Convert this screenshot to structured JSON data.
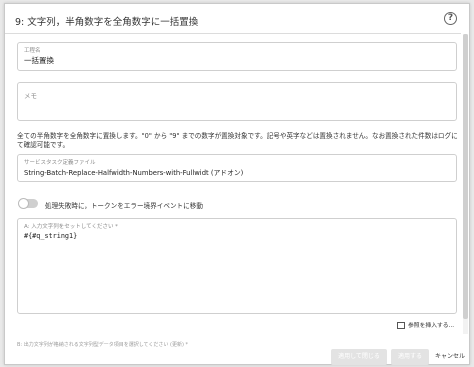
{
  "dialog": {
    "title": "9: 文字列，半角数字を全角数字に一括置換",
    "help_icon": "?"
  },
  "step_name": {
    "label": "工程名",
    "value": "一括置換"
  },
  "memo": {
    "label": "メモ",
    "value": ""
  },
  "description": "全ての半角数字を全角数字に置換します。\"0\" から \"9\" までの数字が置換対象です。記号や英字などは置換されません。なお置換された件数はログにて確認可能です。",
  "service_task": {
    "label": "サービスタスク定義ファイル",
    "value": "String-Batch-Replace-Halfwidth-Numbers-with-Fullwidt (アドオン)"
  },
  "error_toggle": {
    "label": "処理失敗時に，トークンをエラー境界イベントに移動",
    "enabled": false
  },
  "input_string": {
    "label": "A: 入力文字列をセットしてください *",
    "value": "#{#q_string1}"
  },
  "insert_reference": "参照を挿入する...",
  "output_hint": "B: 出力文字列が格納される文字列型データ項目を選択してください (更新) *",
  "buttons": {
    "apply_close": "適用して閉じる",
    "apply": "適用する",
    "cancel": "キャンセル"
  }
}
